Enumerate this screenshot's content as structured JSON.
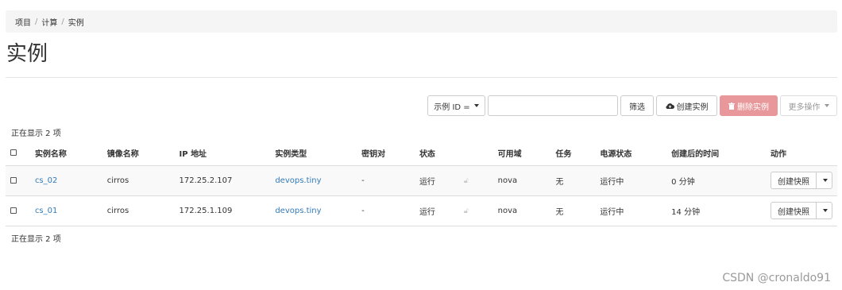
{
  "breadcrumb": [
    "项目",
    "计算",
    "实例"
  ],
  "page_title": "实例",
  "toolbar": {
    "filter_select": "示例 ID =",
    "filter_value": "",
    "filter_button": "筛选",
    "create_button": "创建实例",
    "delete_button": "删除实例",
    "more_button": "更多操作"
  },
  "count_top": "正在显示 2 项",
  "count_bottom": "正在显示 2 项",
  "table": {
    "headers": [
      "实例名称",
      "镜像名称",
      "IP 地址",
      "实例类型",
      "密钥对",
      "状态",
      "可用域",
      "任务",
      "电源状态",
      "创建后的时间",
      "动作"
    ],
    "rows": [
      {
        "name": "cs_02",
        "image": "cirros",
        "ip": "172.25.2.107",
        "flavor": "devops.tiny",
        "keypair": "-",
        "status": "运行",
        "zone": "nova",
        "task": "无",
        "power": "运行中",
        "age": "0 分钟",
        "action": "创建快照"
      },
      {
        "name": "cs_01",
        "image": "cirros",
        "ip": "172.25.1.109",
        "flavor": "devops.tiny",
        "keypair": "-",
        "status": "运行",
        "zone": "nova",
        "task": "无",
        "power": "运行中",
        "age": "14 分钟",
        "action": "创建快照"
      }
    ]
  },
  "watermark": "CSDN @cronaldo91",
  "colors": {
    "link": "#337ab7",
    "danger": "#e8989a",
    "breadcrumb_bg": "#f5f5f5"
  }
}
